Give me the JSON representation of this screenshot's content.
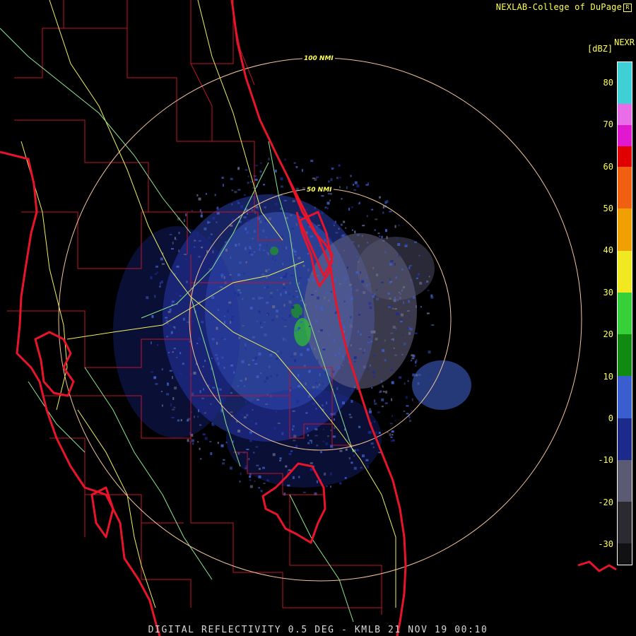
{
  "header": {
    "credit": "NEXLAB-College of DuPage",
    "credit_mark": "R",
    "product": "NEXR",
    "units": "[dBZ]"
  },
  "map": {
    "range_rings": [
      {
        "label": "100 NMI"
      },
      {
        "label": "50 NMI"
      }
    ],
    "colors": {
      "coast": "#e8142a",
      "county": "#c0142a",
      "road": "#f0f060",
      "highway": "#8ee88e",
      "ring": "#f2c49a",
      "echo_light": "#3e5ec8",
      "echo_dark": "#1c2c98",
      "echo_grey": "#6a6a8a",
      "echo_green": "#2ec42e"
    }
  },
  "legend": {
    "ticks": [
      "80",
      "70",
      "60",
      "50",
      "40",
      "30",
      "20",
      "10",
      "0",
      "-10",
      "-20",
      "-30"
    ],
    "scale": [
      {
        "dbz_min": 75,
        "dbz_max": 85,
        "color": "#3fd0d6"
      },
      {
        "dbz_min": 70,
        "dbz_max": 75,
        "color": "#e86ee8"
      },
      {
        "dbz_min": 65,
        "dbz_max": 70,
        "color": "#e018d0"
      },
      {
        "dbz_min": 60,
        "dbz_max": 65,
        "color": "#e00000"
      },
      {
        "dbz_min": 50,
        "dbz_max": 60,
        "color": "#f06010"
      },
      {
        "dbz_min": 40,
        "dbz_max": 50,
        "color": "#f0a000"
      },
      {
        "dbz_min": 30,
        "dbz_max": 40,
        "color": "#f0e820"
      },
      {
        "dbz_min": 20,
        "dbz_max": 30,
        "color": "#38d038"
      },
      {
        "dbz_min": 10,
        "dbz_max": 20,
        "color": "#108a10"
      },
      {
        "dbz_min": 0,
        "dbz_max": 10,
        "color": "#3a5ed0"
      },
      {
        "dbz_min": -10,
        "dbz_max": 0,
        "color": "#1c2a8c"
      },
      {
        "dbz_min": -20,
        "dbz_max": -10,
        "color": "#5a5a72"
      },
      {
        "dbz_min": -30,
        "dbz_max": -20,
        "color": "#2a2a30"
      },
      {
        "dbz_min": -35,
        "dbz_max": -30,
        "color": "#111114"
      }
    ]
  },
  "footer": {
    "caption": "DIGITAL REFLECTIVITY 0.5 DEG - KMLB 21 NOV 19 00:10"
  }
}
